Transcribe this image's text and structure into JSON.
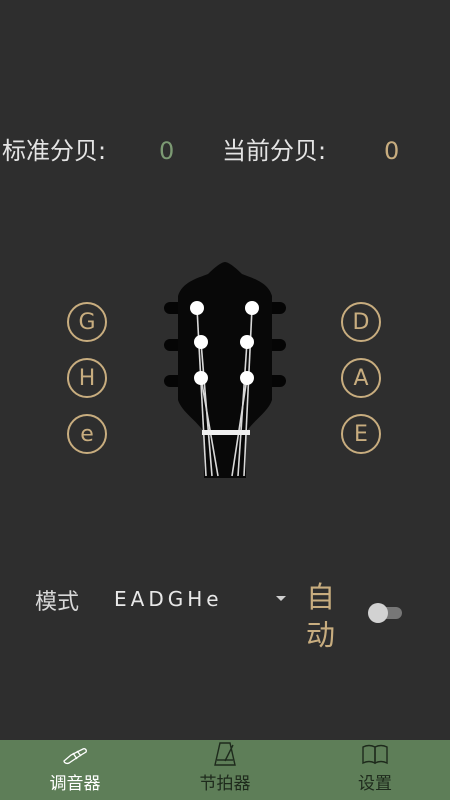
{
  "decibels": {
    "standard_label": "标准分贝:",
    "standard_value": "0",
    "current_label": "当前分贝:",
    "current_value": "0"
  },
  "pegs": {
    "left": [
      "G",
      "H",
      "e"
    ],
    "right": [
      "D",
      "A",
      "E"
    ]
  },
  "mode": {
    "label": "模式",
    "selected": "EADGHe",
    "auto_label": "自动",
    "auto_enabled": false
  },
  "nav": {
    "items": [
      {
        "label": "调音器",
        "icon": "tuner-icon",
        "active": true
      },
      {
        "label": "节拍器",
        "icon": "metronome-icon",
        "active": false
      },
      {
        "label": "设置",
        "icon": "book-icon",
        "active": false
      }
    ]
  },
  "colors": {
    "background": "#2e2e2e",
    "accent": "#c8ad7f",
    "standard_value": "#7c9a73",
    "nav_bar": "#5e7e58"
  }
}
